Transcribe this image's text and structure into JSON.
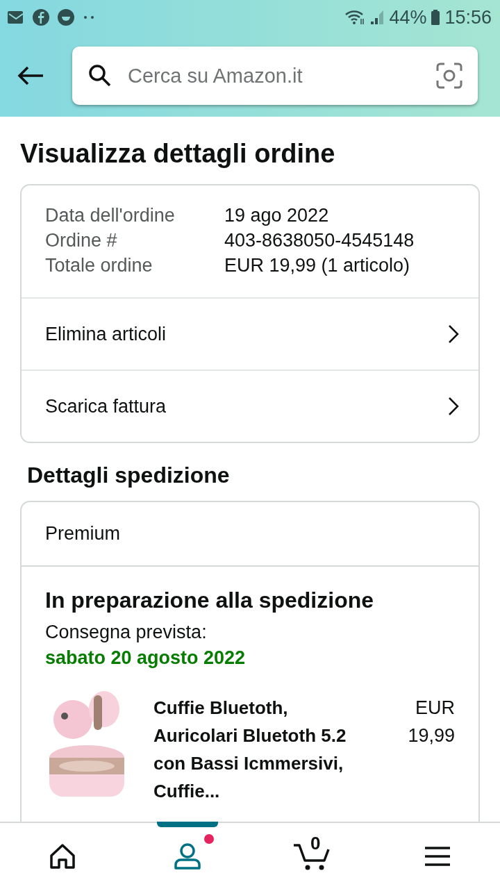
{
  "status_bar": {
    "battery": "44%",
    "time": "15:56"
  },
  "search": {
    "placeholder": "Cerca su Amazon.it"
  },
  "title": "Visualizza dettagli ordine",
  "order_summary": [
    {
      "label": "Data dell'ordine",
      "value": "19 ago 2022"
    },
    {
      "label": "Ordine #",
      "value": "403-8638050-4545148"
    },
    {
      "label": "Totale ordine",
      "value": "EUR 19,99 (1 articolo)"
    }
  ],
  "order_actions": [
    "Elimina articoli",
    "Scarica fattura"
  ],
  "shipping": {
    "heading": "Dettagli spedizione",
    "service": "Premium",
    "status": "In preparazione alla spedizione",
    "delivery_label": "Consegna prevista:",
    "delivery_date": "sabato 20 agosto 2022",
    "item": {
      "kind": "picture",
      "title": "Cuffie Bluetoth, Auricolari Bluetoth 5.2 con Bassi Icmmersivi, Cuffie...",
      "currency": "EUR",
      "price": "19,99"
    }
  },
  "bottom_nav": [
    {
      "kind": "home",
      "selected": false,
      "badge": false
    },
    {
      "kind": "account",
      "selected": true,
      "badge": true
    },
    {
      "kind": "cart",
      "selected": false,
      "badge": false,
      "count": "0"
    },
    {
      "kind": "menu",
      "selected": false,
      "badge": false
    }
  ]
}
